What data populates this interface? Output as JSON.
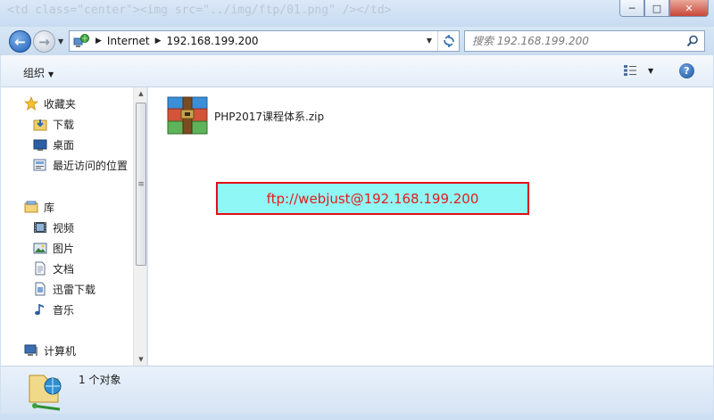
{
  "title_bar": {
    "background_code": "<td class=\"center\"><img src=\"../img/ftp/01.png\" /></td>"
  },
  "window_controls": {
    "minimize": "─",
    "maximize": "□",
    "close": "✕"
  },
  "address": {
    "crumbs": [
      "Internet",
      "192.168.199.200"
    ],
    "refresh_icon": "refresh-icon"
  },
  "search": {
    "placeholder": "搜索 192.168.199.200"
  },
  "toolbar": {
    "organize_label": "组织",
    "help_label": "?"
  },
  "sidebar": {
    "favorites_header": "收藏夹",
    "favorites": [
      {
        "label": "下载",
        "icon": "download-folder-icon"
      },
      {
        "label": "桌面",
        "icon": "desktop-icon"
      },
      {
        "label": "最近访问的位置",
        "icon": "recent-places-icon"
      }
    ],
    "libraries_header": "库",
    "libraries": [
      {
        "label": "视频",
        "icon": "video-icon"
      },
      {
        "label": "图片",
        "icon": "picture-icon"
      },
      {
        "label": "文档",
        "icon": "document-icon"
      },
      {
        "label": "迅雷下载",
        "icon": "thunder-download-icon"
      },
      {
        "label": "音乐",
        "icon": "music-icon"
      }
    ],
    "computer_header": "计算机"
  },
  "content": {
    "files": [
      {
        "name": "PHP2017课程体系.zip",
        "icon": "winrar-archive-icon"
      }
    ],
    "annotation": "ftp://webjust@192.168.199.200"
  },
  "status": {
    "text": "1 个对象"
  },
  "colors": {
    "annotation_bg": "#8ff8f6",
    "annotation_border": "#e30d17",
    "annotation_text": "#e41b1b"
  }
}
